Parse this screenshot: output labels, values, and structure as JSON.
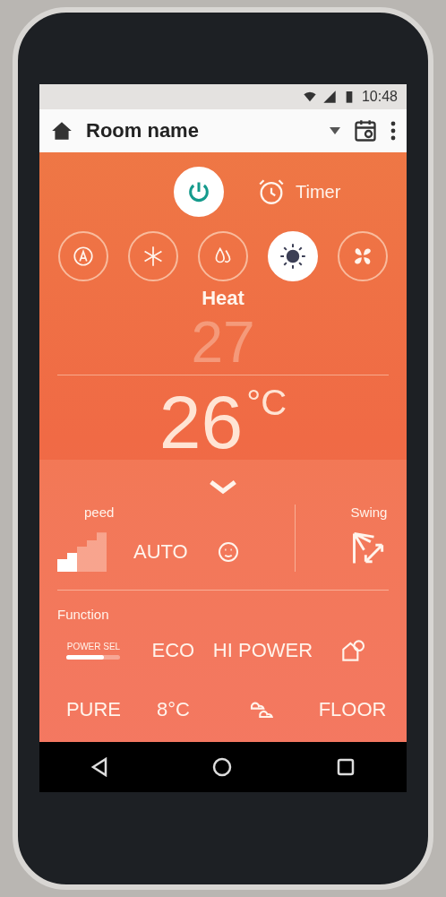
{
  "status_bar": {
    "time": "10:48"
  },
  "app_bar": {
    "title": "Room name"
  },
  "power": {
    "on": true
  },
  "timer": {
    "label": "Timer"
  },
  "modes": [
    {
      "kind": "auto",
      "selected": false
    },
    {
      "kind": "cool",
      "selected": false
    },
    {
      "kind": "dry",
      "selected": false
    },
    {
      "kind": "heat",
      "selected": true
    },
    {
      "kind": "fan",
      "selected": false
    }
  ],
  "mode_label": "Heat",
  "temperature": {
    "target": "27",
    "current": "26",
    "unit": "°C"
  },
  "fan_speed": {
    "label": "peed",
    "level": 0.4,
    "auto_label": "AUTO"
  },
  "swing": {
    "label": "Swing"
  },
  "function": {
    "label": "Function",
    "items": [
      {
        "kind": "slider",
        "label": "POWER SEL",
        "level": 0.7
      },
      {
        "kind": "text",
        "label": "ECO"
      },
      {
        "kind": "text",
        "label": "HI POWER"
      },
      {
        "kind": "icon"
      },
      {
        "kind": "text",
        "label": "PURE"
      },
      {
        "kind": "text",
        "label": "8°C"
      },
      {
        "kind": "icon2"
      },
      {
        "kind": "text",
        "label": "FLOOR"
      }
    ]
  }
}
